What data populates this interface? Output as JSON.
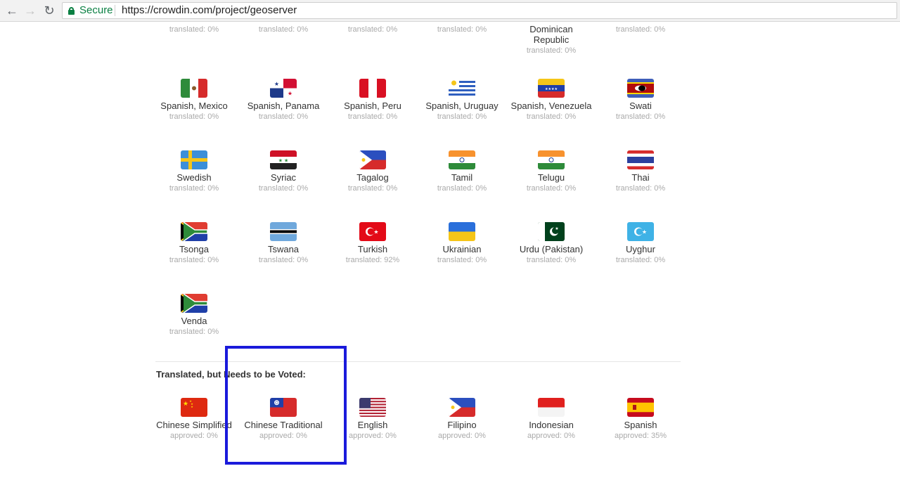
{
  "browser": {
    "back_icon": "arrow-left-icon",
    "forward_icon": "arrow-right-icon",
    "reload_icon": "reload-icon",
    "secure_label": "Secure",
    "url": "https://crowdin.com/project/geoserver"
  },
  "partial_row": [
    {
      "name": "",
      "status": "translated: 0%"
    },
    {
      "name": "",
      "status": "translated: 0%"
    },
    {
      "name": "",
      "status": "translated: 0%"
    },
    {
      "name": "",
      "status": "translated: 0%"
    },
    {
      "name": "Dominican Republic",
      "status": "translated: 0%"
    },
    {
      "name": "",
      "status": "translated: 0%"
    }
  ],
  "languages": [
    {
      "name": "Spanish, Mexico",
      "status": "translated: 0%",
      "flag": "mexico"
    },
    {
      "name": "Spanish, Panama",
      "status": "translated: 0%",
      "flag": "panama"
    },
    {
      "name": "Spanish, Peru",
      "status": "translated: 0%",
      "flag": "peru"
    },
    {
      "name": "Spanish, Uruguay",
      "status": "translated: 0%",
      "flag": "uruguay"
    },
    {
      "name": "Spanish, Venezuela",
      "status": "translated: 0%",
      "flag": "venezuela"
    },
    {
      "name": "Swati",
      "status": "translated: 0%",
      "flag": "swaziland"
    },
    {
      "name": "Swedish",
      "status": "translated: 0%",
      "flag": "sweden"
    },
    {
      "name": "Syriac",
      "status": "translated: 0%",
      "flag": "syria"
    },
    {
      "name": "Tagalog",
      "status": "translated: 0%",
      "flag": "philippines"
    },
    {
      "name": "Tamil",
      "status": "translated: 0%",
      "flag": "india"
    },
    {
      "name": "Telugu",
      "status": "translated: 0%",
      "flag": "india"
    },
    {
      "name": "Thai",
      "status": "translated: 0%",
      "flag": "thailand"
    },
    {
      "name": "Tsonga",
      "status": "translated: 0%",
      "flag": "south-africa"
    },
    {
      "name": "Tswana",
      "status": "translated: 0%",
      "flag": "botswana"
    },
    {
      "name": "Turkish",
      "status": "translated: 92%",
      "flag": "turkey"
    },
    {
      "name": "Ukrainian",
      "status": "translated: 0%",
      "flag": "ukraine"
    },
    {
      "name": "Urdu (Pakistan)",
      "status": "translated: 0%",
      "flag": "pakistan"
    },
    {
      "name": "Uyghur",
      "status": "translated: 0%",
      "flag": "east-turkestan"
    },
    {
      "name": "Venda",
      "status": "translated: 0%",
      "flag": "south-africa"
    }
  ],
  "voting_section": {
    "title": "Translated, but Needs to be Voted:",
    "languages": [
      {
        "name": "Chinese Simplified",
        "status": "approved: 0%",
        "flag": "china"
      },
      {
        "name": "Chinese Traditional",
        "status": "approved: 0%",
        "flag": "taiwan"
      },
      {
        "name": "English",
        "status": "approved: 0%",
        "flag": "usa"
      },
      {
        "name": "Filipino",
        "status": "approved: 0%",
        "flag": "philippines"
      },
      {
        "name": "Indonesian",
        "status": "approved: 0%",
        "flag": "indonesia"
      },
      {
        "name": "Spanish",
        "status": "approved: 35%",
        "flag": "spain"
      }
    ]
  },
  "colors": {
    "highlight_border": "#1a1adb",
    "secure_green": "#0b8043"
  }
}
